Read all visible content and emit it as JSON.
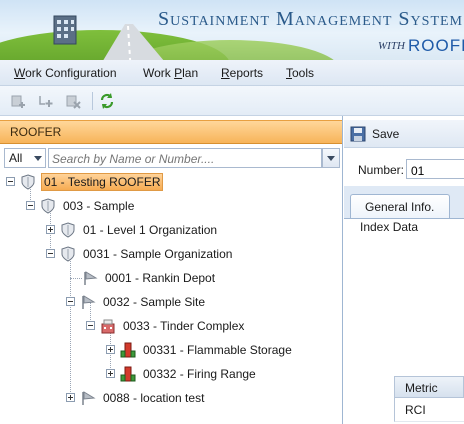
{
  "banner": {
    "title": "Sustainment Management System",
    "with": "WITH",
    "product": "ROOFER"
  },
  "menu": {
    "items": [
      {
        "label": "Work Configuration",
        "hotkey": "W",
        "rest": "ork Configuration"
      },
      {
        "label": "Work Plan",
        "hotkey": "P",
        "pre": "Work ",
        "rest": "lan"
      },
      {
        "label": "Reports",
        "hotkey": "R",
        "rest": "eports"
      },
      {
        "label": "Tools",
        "hotkey": "T",
        "rest": "ools"
      }
    ]
  },
  "toolbar": {
    "buttons": [
      "add-node-icon",
      "add-child-icon",
      "delete-node-icon",
      "refresh-icon"
    ]
  },
  "left": {
    "header": "ROOFER",
    "filter": {
      "selected": "All"
    },
    "search": {
      "placeholder": "Search by Name or Number...."
    },
    "tree": [
      {
        "label": "01 - Testing ROOFER",
        "icon": "shield-icon",
        "selected": true
      },
      {
        "label": "003 - Sample",
        "icon": "shield-icon"
      },
      {
        "label": "01 - Level 1 Organization",
        "icon": "shield-icon"
      },
      {
        "label": "0031 - Sample Organization",
        "icon": "shield-icon"
      },
      {
        "label": "0001 - Rankin Depot",
        "icon": "site-flag-icon"
      },
      {
        "label": "0032 - Sample Site",
        "icon": "site-flag-icon"
      },
      {
        "label": "0033 - Tinder Complex",
        "icon": "complex-icon"
      },
      {
        "label": "00331 - Flammable Storage",
        "icon": "building-icon"
      },
      {
        "label": "00332 - Firing Range",
        "icon": "building-icon"
      },
      {
        "label": "0088 - location test",
        "icon": "site-flag-icon"
      }
    ]
  },
  "right": {
    "save_label": "Save",
    "number_label": "Number:",
    "number_value": "01",
    "tab_label": "General Info.",
    "index_label": "Index Data",
    "metric_header": "Metric",
    "metric_rows": [
      "RCI"
    ]
  },
  "colors": {
    "accent_orange": "#f6ab52",
    "brand_blue": "#1e5aa8"
  }
}
